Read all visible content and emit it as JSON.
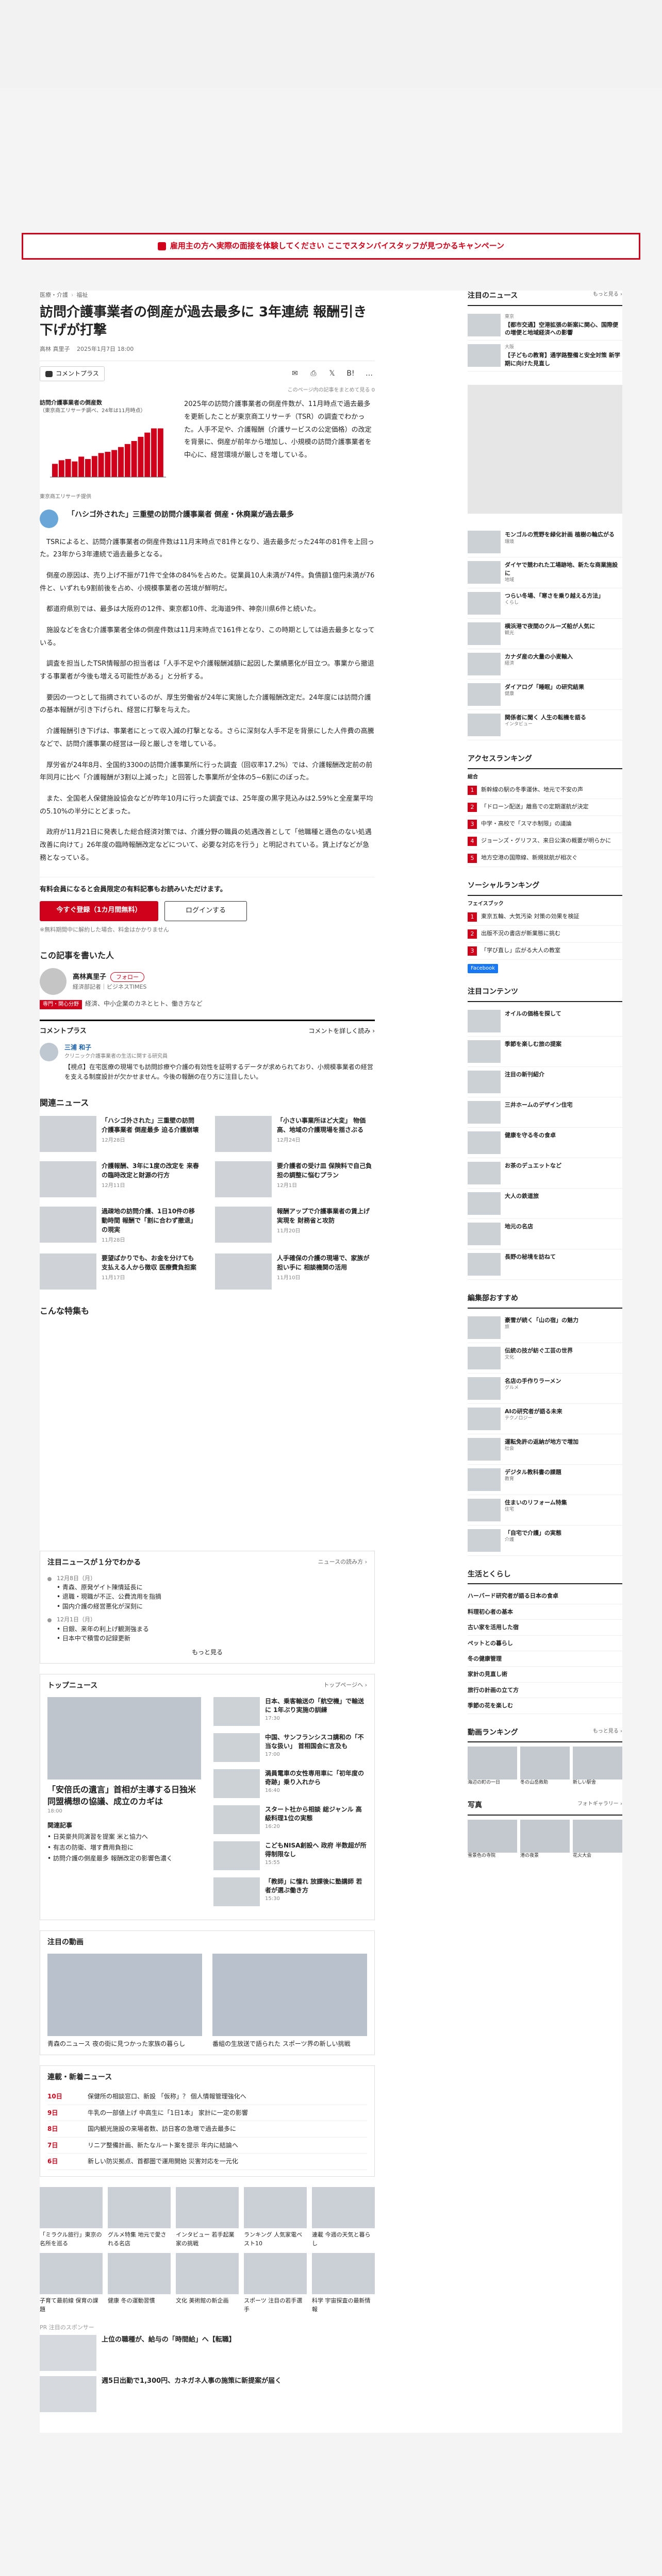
{
  "campaign": "雇用主の方へ実際の面接を体験してください ここでスタンバイスタッフが見つかるキャンペーン",
  "article": {
    "breadcrumb": [
      "医療・介護",
      "福祉"
    ],
    "title": "訪問介護事業者の倒産が過去最多に 3年連続 報酬引き下げが打撃",
    "meta": [
      "高林 真里子",
      "2025年1月7日 18:00"
    ],
    "comment_label": "コメントプラス",
    "counts": "このページ内の記事をまとめて見る 0",
    "chart_caption_1": "訪問介護事業者の倒産数",
    "chart_caption_2": "（東京商工リサーチ調べ、24年は11月時点）",
    "chart_source": "東京商工リサーチ提供",
    "intro": "2025年の訪問介護事業者の倒産件数が、11月時点で過去最多を更新したことが東京商工リサーチ（TSR）の調査でわかった。人手不足や、介護報酬（介護サービスの公定価格）の改定を背景に、倒産が前年から増加し、小規模の訪問介護事業者を中心に、経営環境が厳しさを増している。",
    "subhead": "「ハシゴ外された」三重壁の訪問介護事業者 倒産・休廃業が過去最多",
    "paragraphs": [
      "TSRによると、訪問介護事業者の倒産件数は11月末時点で81件となり、過去最多だった24年の81件を上回った。23年から3年連続で過去最多となる。",
      "倒産の原因は、売り上げ不振が71件で全体の84%を占めた。従業員10人未満が74件。負債額1億円未満が76件と、いずれも9割前後を占め、小規模事業者の苦境が鮮明だ。",
      "都道府県別では、最多は大阪府の12件、東京都10件、北海道9件、神奈川県6件と続いた。",
      "施設などを含む介護事業者全体の倒産件数は11月末時点で161件となり、この時期としては過去最多となっている。",
      "調査を担当したTSR情報部の担当者は「人手不足や介護報酬減額に起因した業績悪化が目立つ。事業から撤退する事業者が今後も増える可能性がある」と分析する。",
      "要因の一つとして指摘されているのが、厚生労働省が24年に実施した介護報酬改定だ。24年度には訪問介護の基本報酬が引き下げられ、経営に打撃を与えた。",
      "介護報酬引き下げは、事業者にとって収入減の打撃となる。さらに深刻な人手不足を背景にした人件費の高騰などで、訪問介護事業の経営は一段と厳しさを増している。",
      "厚労省が24年8月、全国約3300の訪問介護事業所に行った調査（回収率17.2%）では、介護報酬改定前の前年同月に比べ「介護報酬が3割以上減った」と回答した事業所が全体の5~6割にのぼった。",
      "また、全国老人保健施設協会などが昨年10月に行った調査では、25年度の黒字見込みは2.59%と全産業平均の5.10%の半分にとどまった。",
      "政府が11月21日に発表した総合経済対策では、介護分野の職員の処遇改善として「他職種と遜色のない処遇改善に向けて」26年度の臨時報酬改定などについて、必要な対応を行う」と明記されている。賃上げなどが急務となっている。"
    ],
    "paywall": {
      "title": "有料会員になると会員限定の有料記事もお読みいただけます。",
      "subscribe": "今すぐ登録（1カ月間無料）",
      "login": "ログインする",
      "note": "※無料期間中に解約した場合、料金はかかりません"
    }
  },
  "author_section": {
    "heading": "この記事を書いた人",
    "name": "高林真里子",
    "role": "経済部記者｜ビジネスTIMES",
    "follow": "フォロー",
    "badge": "専門・関心分野",
    "desc": "経済、中小企業のカネとヒト、働き方など"
  },
  "comment_plus": {
    "heading": "コメントプラス",
    "link": "コメントを詳しく読み ›",
    "commenter": "三浦 和子",
    "commenter_role": "クリニック介護事業者の生活に関する研究員",
    "text": "【視点】在宅医療の現場でも訪問診療や介護の有効性を証明するデータが求められており、小規模事業者の経営を支える制度設計が欠かせません。今後の報酬の在り方に注目したい。"
  },
  "related": {
    "heading": "関連ニュース",
    "items": [
      {
        "title": "「ハシゴ外された」三重壁の訪問介護事業者 倒産最多 迫る介護崩壊",
        "time": "12月28日"
      },
      {
        "title": "「小さい事業所ほど大変」 物価高、地域の介護現場を揺さぶる",
        "time": "12月24日"
      },
      {
        "title": "介護報酬、3年に1度の改定を 来春の臨時改定と財源の行方",
        "time": "12月11日"
      },
      {
        "title": "要介護者の受け皿 保険料で自己負担の調整に悩むプラン",
        "time": "12月1日"
      },
      {
        "title": "過疎地の訪問介護、1日10件の移動時間 報酬で「割に合わず撤退」の現実",
        "time": "11月28日"
      },
      {
        "title": "報酬アップで介護事業者の賃上げ実現を 財務省と攻防",
        "time": "11月20日"
      },
      {
        "title": "要望ばかりでも、お金を分けても 支払える人から徴収 医療費負担案",
        "time": "11月17日"
      },
      {
        "title": "人手確保の介護の現場で、家族が担い手に 相談機関の活用",
        "time": "11月10日"
      }
    ]
  },
  "also_read_heading": "こんな特集も",
  "timeline": {
    "heading": "注目ニュースが１分でわかる",
    "more_link": "ニュースの読み方 ›",
    "entries": [
      {
        "date": "12月8日（月）",
        "lines": [
          "• 青森、原発ゲイト陳情延長に",
          "• 退職・現職が不正、公費流用を指摘",
          "• 国内介護の経営悪化が深刻に"
        ]
      },
      {
        "date": "12月1日（月）",
        "lines": [
          "• 日銀、来年の利上げ観測強まる",
          "• 日本中で積雪の記録更新"
        ]
      }
    ],
    "more": "もっと見る"
  },
  "topics": {
    "heading": "トップニュース",
    "more": "トップページへ ›",
    "lead_title": "「安倍氏の遺言」首相が主導する日独米同盟構想の協議、成立のカギは",
    "lead_time": "18:00",
    "rel_heading": "関連記事",
    "rel_items": [
      "• 日英豪共同演習を提案 米と協力へ",
      "• 有志の防衛、増す費用負担に",
      "• 訪問介護の倒産最多 報酬改定の影響色濃く"
    ],
    "items": [
      {
        "title": "日本、乗客輸送の「航空機」で輸送に 1年ぶり実施の訓練",
        "time": "17:30"
      },
      {
        "title": "中国、サンフランシスコ講和の「不当な扱い」 首相国会に言及も",
        "time": "17:00"
      },
      {
        "title": "満員電車の女性専用車に「初年度の奇跡」乗り入れから",
        "time": "16:40"
      },
      {
        "title": "スタート社から相談 総ジャンル 高級料理1位の実態",
        "time": "16:20"
      },
      {
        "title": "こどもNISA創設へ 政府 半数超が所得制限なし",
        "time": "15:55"
      },
      {
        "title": "「教師」に憧れ 放課後に塾講師 若者が選ぶ働き方",
        "time": "15:30"
      }
    ]
  },
  "picks": {
    "heading": "注目の動画",
    "items": [
      {
        "title": "青森のニュース 夜の街に見つかった家族の暮らし"
      },
      {
        "title": "番組の生放送で語られた スポーツ界の新しい挑戦"
      }
    ]
  },
  "categories": {
    "heading": "連載・新着ニュース",
    "rows": [
      {
        "tag": "10日",
        "text": "保健所の相談窓口、新設 「仮称」？ 個人情報管理強化へ"
      },
      {
        "tag": "9日",
        "text": "牛乳の一部値上げ 中高生に「1日1本」 家計に一定の影響"
      },
      {
        "tag": "8日",
        "text": "国内観光施設の来場者数、訪日客の急増で過去最多に"
      },
      {
        "title": "",
        "tag": "7日",
        "text": "リニア整備計画、新たなルート案を提示 年内に結論へ"
      },
      {
        "tag": "6日",
        "text": "新しい防災拠点、首都圏で運用開始 災害対応を一元化"
      }
    ]
  },
  "grid": {
    "items": [
      {
        "title": "「ミラクル旅行」東京の名所を巡る"
      },
      {
        "title": "グルメ特集 地元で愛される名店"
      },
      {
        "title": "インタビュー 若手起業家の挑戦"
      },
      {
        "title": "ランキング 人気家電ベスト10"
      },
      {
        "title": "連載 今週の天気と暮らし"
      },
      {
        "title": "子育て最前線 保育の課題"
      },
      {
        "title": "健康 冬の運動習慣"
      },
      {
        "title": "文化 美術館の新企画"
      },
      {
        "title": "スポーツ 注目の若手選手"
      },
      {
        "title": "科学 宇宙探査の最新情報"
      }
    ]
  },
  "pr": {
    "label": "PR 注目のスポンサー",
    "items": [
      {
        "title": "上位の職種が、給与の「時間給」へ【転職】"
      },
      {
        "title": "週5日出勤で1,300円、カネガネ人事の施策に新提案が届く"
      }
    ]
  },
  "sidebar": {
    "pickup_heading": "注目のニュース",
    "pickup_more": "もっと見る ›",
    "pickup": [
      {
        "tag": "東京",
        "title": "【都市交通】空港拡張の新案に関心、国際便の増便と地域経済への影響"
      },
      {
        "tag": "大阪",
        "title": "【子どもの教育】通学路整備と安全対策 新学期に向けた見直し"
      }
    ],
    "ranking_heading": "アクセスランキング",
    "ranking_sub": "総合",
    "ranking": [
      "新幹線の駅の冬季運休、地元で不安の声",
      "「ドローン配送」離島での定期運航が決定",
      "中学・高校で「スマホ制限」の議論",
      "ジョーンズ・グリフス、来日公演の概要が明らかに",
      "地方空港の国際線、新規就航が相次ぐ"
    ],
    "news_list": [
      {
        "title": "モンゴルの荒野を緑化計画 植樹の輪広がる",
        "sub": "環境"
      },
      {
        "title": "ダイヤで競われた工場跡地、新たな商業施設に",
        "sub": "地域"
      },
      {
        "title": "つらい冬場、「寒さを乗り越える方法」",
        "sub": "くらし"
      },
      {
        "title": "横浜港で夜間のクルーズ船が人気に",
        "sub": "観光"
      },
      {
        "title": "カナダ産の大量の小麦輸入",
        "sub": "経済"
      },
      {
        "title": "ダイアログ「睡眠」の研究結果",
        "sub": "健康"
      },
      {
        "title": "関係者に聞く 人生の転機を語る",
        "sub": "インタビュー"
      }
    ],
    "social_heading": "ソーシャルランキング",
    "social_sub": "フェイスブック",
    "social": [
      "東京五輪、大気汚染 対策の効果を検証",
      "出版不況の書店が新業態に挑む",
      "「学び直し」広がる大人の教室"
    ],
    "fb": "Facebook",
    "photos_heading": "注目コンテンツ",
    "photos": [
      {
        "title": "オイルの価格を探して"
      },
      {
        "title": "季節を楽しむ旅の提案"
      },
      {
        "title": "注目の新刊紹介"
      },
      {
        "title": "三井ホームのデザイン住宅"
      },
      {
        "title": "健康を守る冬の食卓"
      },
      {
        "title": "お茶のデュエットなど"
      },
      {
        "title": "大人の鉄道旅"
      },
      {
        "title": "地元の名店"
      },
      {
        "title": "長野の秘境を訪ねて"
      }
    ],
    "editors_heading": "編集部おすすめ",
    "editors": [
      {
        "title": "豪雪が続く「山の宿」の魅力",
        "sub": "旅"
      },
      {
        "title": "伝統の技が紡ぐ工芸の世界",
        "sub": "文化"
      },
      {
        "title": "名店の手作りラーメン",
        "sub": "グルメ"
      },
      {
        "title": "AIの研究者が語る未来",
        "sub": "テクノロジー"
      },
      {
        "title": "運転免許の返納が地方で増加",
        "sub": "社会"
      },
      {
        "title": "デジタル教科書の課題",
        "sub": "教育"
      },
      {
        "title": "住まいのリフォーム特集",
        "sub": "住宅"
      },
      {
        "title": "「自宅で介護」の実態",
        "sub": "介護"
      }
    ],
    "lifestyle_heading": "生活とくらし",
    "lifestyle": [
      "ハーバード研究者が語る日本の食卓",
      "料理初心者の基本",
      "古い家を活用した宿",
      "ペットとの暮らし",
      "冬の健康管理",
      "家計の見直し術",
      "旅行の計画の立て方",
      "季節の花を楽しむ"
    ],
    "video_heading": "動画ランキング",
    "video_more": "もっと見る ›",
    "videos": [
      {
        "title": "海辺の町の一日"
      },
      {
        "title": "冬の山岳救助"
      },
      {
        "title": "新しい駅舎"
      }
    ],
    "photo_heading": "写真",
    "photo_more": "フォトギャラリー ›",
    "photo_items": [
      {
        "title": "雪景色の寺院"
      },
      {
        "title": "港の夜景"
      },
      {
        "title": "花火大会"
      }
    ]
  }
}
